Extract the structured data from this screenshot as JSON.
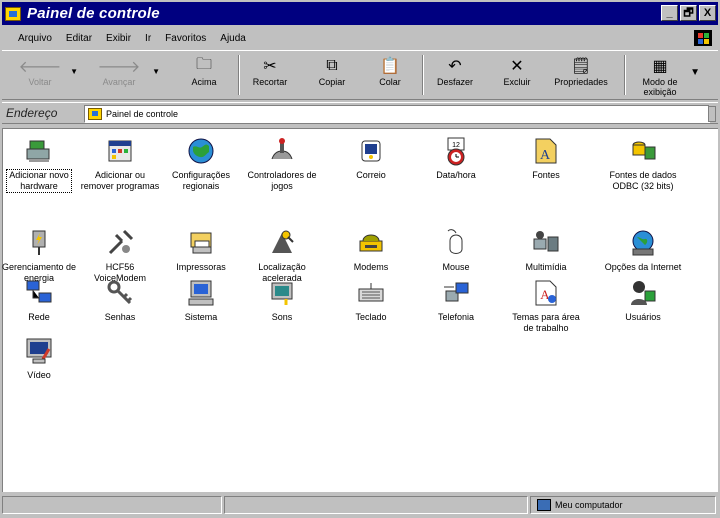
{
  "window": {
    "title": "Painel de controle"
  },
  "titlebar_buttons": {
    "minimize": "_",
    "maximize": "🗗",
    "close": "X"
  },
  "menu": [
    "Arquivo",
    "Editar",
    "Exibir",
    "Ir",
    "Favoritos",
    "Ajuda"
  ],
  "toolbar": {
    "back": "Voltar",
    "forward": "Avançar",
    "up": "Acima",
    "cut": "Recortar",
    "copy": "Copiar",
    "paste": "Colar",
    "undo": "Desfazer",
    "delete": "Excluir",
    "properties": "Propriedades",
    "views": "Modo de\nexibição"
  },
  "address": {
    "label": "Endereço",
    "value": "Painel de controle"
  },
  "items": [
    {
      "label": "Adicionar novo\nhardware",
      "icon": "add-hardware-icon"
    },
    {
      "label": "Adicionar ou\nremover programas",
      "icon": "add-remove-programs-icon"
    },
    {
      "label": "Configurações\nregionais",
      "icon": "regional-settings-icon"
    },
    {
      "label": "Controladores de\njogos",
      "icon": "game-controllers-icon"
    },
    {
      "label": "Correio",
      "icon": "mail-icon"
    },
    {
      "label": "Data/hora",
      "icon": "date-time-icon"
    },
    {
      "label": "Fontes",
      "icon": "fonts-icon"
    },
    {
      "label": "Fontes de dados\nODBC (32 bits)",
      "icon": "odbc-icon"
    },
    {
      "label": "Gerenciamento de\nenergia",
      "icon": "power-management-icon"
    },
    {
      "label": "HCF56\nVoiceModem",
      "icon": "voice-modem-icon"
    },
    {
      "label": "Impressoras",
      "icon": "printers-icon"
    },
    {
      "label": "Localização\nacelerada",
      "icon": "find-fast-icon"
    },
    {
      "label": "Modems",
      "icon": "modems-icon"
    },
    {
      "label": "Mouse",
      "icon": "mouse-icon"
    },
    {
      "label": "Multimídia",
      "icon": "multimedia-icon"
    },
    {
      "label": "Opções da Internet",
      "icon": "internet-options-icon"
    },
    {
      "label": "Rede",
      "icon": "network-icon"
    },
    {
      "label": "Senhas",
      "icon": "passwords-icon"
    },
    {
      "label": "Sistema",
      "icon": "system-icon"
    },
    {
      "label": "Sons",
      "icon": "sounds-icon"
    },
    {
      "label": "Teclado",
      "icon": "keyboard-icon"
    },
    {
      "label": "Telefonia",
      "icon": "telephony-icon"
    },
    {
      "label": "Temas para área\nde trabalho",
      "icon": "desktop-themes-icon"
    },
    {
      "label": "Usuários",
      "icon": "users-icon"
    },
    {
      "label": "Vídeo",
      "icon": "display-icon"
    }
  ],
  "status": {
    "zone": "Meu computador"
  },
  "colors": {
    "titlebar": "#000080",
    "face": "#c0c0c0",
    "content_bg": "#ffffff"
  }
}
